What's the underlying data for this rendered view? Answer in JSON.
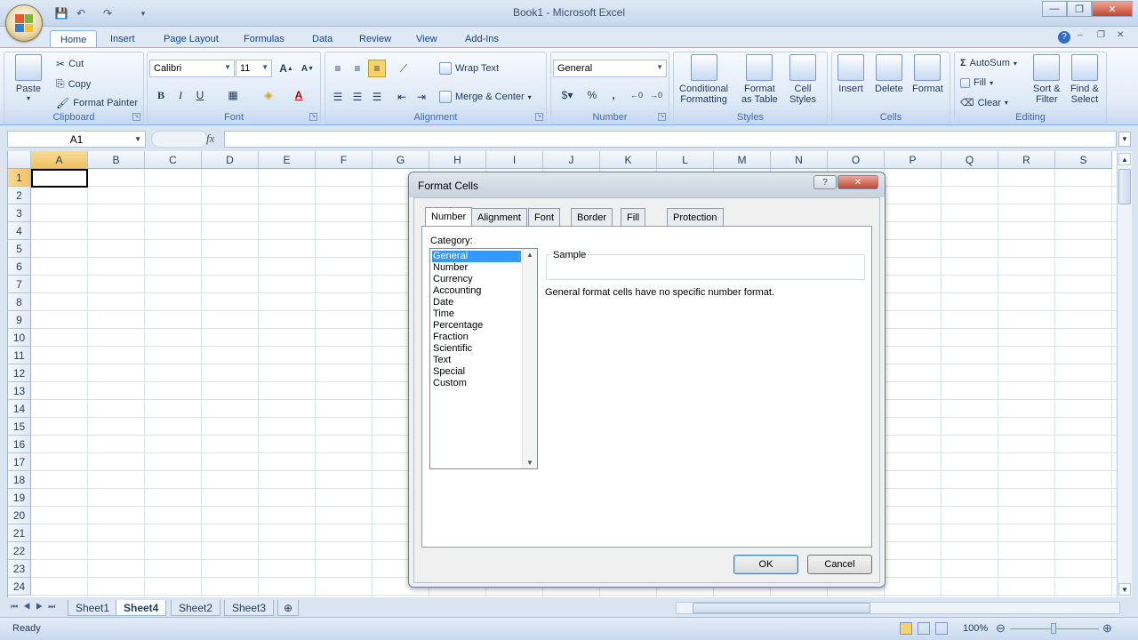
{
  "window": {
    "title": "Book1 - Microsoft Excel",
    "controls": [
      "—",
      "❐",
      "✕"
    ]
  },
  "tabs": [
    "Home",
    "Insert",
    "Page Layout",
    "Formulas",
    "Data",
    "Review",
    "View",
    "Add-Ins"
  ],
  "ribbon": {
    "clipboard": {
      "label": "Clipboard",
      "paste": "Paste",
      "cut": "Cut",
      "copy": "Copy",
      "format_painter": "Format Painter"
    },
    "font": {
      "label": "Font",
      "name": "Calibri",
      "size": "11",
      "bold": "B",
      "italic": "I",
      "underline": "U",
      "grow": "A",
      "shrink": "A"
    },
    "alignment": {
      "label": "Alignment",
      "wrap_text": "Wrap Text",
      "merge_center": "Merge & Center"
    },
    "number": {
      "label": "Number",
      "format": "General",
      "percent": "%",
      "comma": ","
    },
    "styles": {
      "label": "Styles",
      "conditional_1": "Conditional",
      "conditional_2": "Formatting",
      "format_table_1": "Format",
      "format_table_2": "as Table",
      "cell_styles_1": "Cell",
      "cell_styles_2": "Styles"
    },
    "cells": {
      "label": "Cells",
      "insert": "Insert",
      "delete": "Delete",
      "format": "Format"
    },
    "editing": {
      "label": "Editing",
      "autosum": "AutoSum",
      "fill": "Fill",
      "clear": "Clear",
      "sort_1": "Sort &",
      "sort_2": "Filter",
      "find_1": "Find &",
      "find_2": "Select"
    }
  },
  "formula_bar": {
    "name_box": "A1",
    "fx": "fx",
    "value": ""
  },
  "grid": {
    "columns": [
      "A",
      "B",
      "C",
      "D",
      "E",
      "F",
      "G",
      "H",
      "I",
      "J",
      "K",
      "L",
      "M",
      "N",
      "O",
      "P",
      "Q",
      "R",
      "S"
    ],
    "rows": [
      "1",
      "2",
      "3",
      "4",
      "5",
      "6",
      "7",
      "8",
      "9",
      "10",
      "11",
      "12",
      "13",
      "14",
      "15",
      "16",
      "17",
      "18",
      "19",
      "20",
      "21",
      "22",
      "23",
      "24"
    ]
  },
  "sheets": {
    "tabs": [
      "Sheet1",
      "Sheet4",
      "Sheet2",
      "Sheet3"
    ],
    "active": "Sheet4"
  },
  "status": {
    "text": "Ready",
    "zoom": "100%"
  },
  "dialog": {
    "title": "Format Cells",
    "help": "?",
    "close": "✕",
    "tabs": [
      "Number",
      "Alignment",
      "Font",
      "Border",
      "Fill",
      "Protection"
    ],
    "category_label": "Category:",
    "categories": [
      "General",
      "Number",
      "Currency",
      "Accounting",
      "Date",
      "Time",
      "Percentage",
      "Fraction",
      "Scientific",
      "Text",
      "Special",
      "Custom"
    ],
    "selected_category": "General",
    "sample_label": "Sample",
    "description": "General format cells have no specific number format.",
    "ok": "OK",
    "cancel": "Cancel"
  }
}
